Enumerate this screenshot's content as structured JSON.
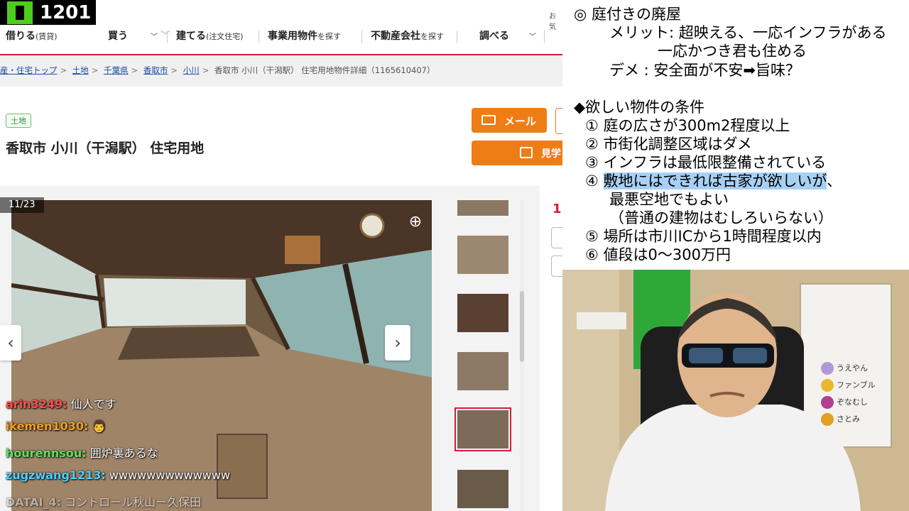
{
  "stream": {
    "logo_number": "1201"
  },
  "site": {
    "fav_text": "お気",
    "nav": [
      {
        "label": "借りる",
        "sub": "(賃貸)"
      },
      {
        "label": "買う",
        "sub": ""
      },
      {
        "label": "建てる",
        "sub": "(注文住宅)"
      },
      {
        "label": "事業用物件",
        "sub": "を探す"
      },
      {
        "label": "不動産会社",
        "sub": "を探す"
      },
      {
        "label": "調べる",
        "sub": ""
      }
    ],
    "breadcrumbs": [
      "産・住宅トップ",
      "土地",
      "千葉県",
      "香取市",
      "小川"
    ],
    "breadcrumb_current": "香取市 小川（干潟駅） 住宅用地物件詳細（1165610407）",
    "badge": "土地",
    "title": "香取市 小川（干潟駅） 住宅用地",
    "mail_label": "メール",
    "visit_label": "見学",
    "photo_counter": "11/23",
    "side_price_glimpse": "1("
  },
  "chat": [
    {
      "user": "arin3249:",
      "msg": "仙人です",
      "color": "#ff5050"
    },
    {
      "user": "ikemen1030:",
      "msg": "👨",
      "color": "#f0a020"
    },
    {
      "user": "hourennsou:",
      "msg": "囲炉裏あるな",
      "color": "#60e060"
    },
    {
      "user": "zugzwang1213:",
      "msg": "wwwwwwwwwwwww",
      "color": "#50d0ff"
    },
    {
      "user": "DATAI_4:",
      "msg": "コントロール秋山ー久保田",
      "color": "#c8c8c8"
    }
  ],
  "notes": {
    "l1": "◎ 庭付きの廃屋",
    "l2": "メリット: 超映える、一応インフラがある",
    "l3": "一応かつき君も住める",
    "l4": "デメ : 安全面が不安➡旨味？",
    "l5": "◆欲しい物件の条件",
    "c1": "① 庭の広さが300m2程度以上",
    "c2": "② 市街化調整区域はダメ",
    "c3": "③ インフラは最低限整備されている",
    "c4a": "④ ",
    "c4b": "敷地にはできれば古家が欲しいが",
    "c4c": "、",
    "c4d": "最悪空地でもよい",
    "c4e": "（普通の建物はむしろいらない）",
    "c5": "⑤ 場所は市川ICから1時間程度以内",
    "c6": "⑥ 値段は0～300万円"
  },
  "members": [
    {
      "name": "うえやん",
      "color": "#b098d8"
    },
    {
      "name": "ファンブル",
      "color": "#e8b830"
    },
    {
      "name": "ぞなむし",
      "color": "#b04090"
    },
    {
      "name": "さとみ",
      "color": "#e0a020"
    }
  ]
}
